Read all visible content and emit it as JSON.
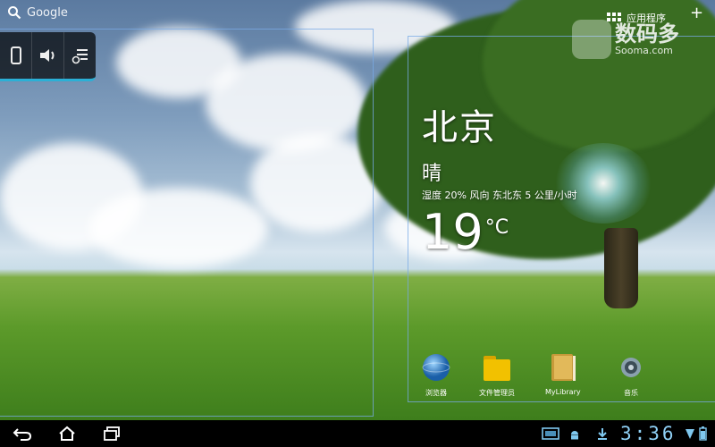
{
  "search": {
    "label": "Google"
  },
  "settings_widget": {
    "items": [
      "phone-icon",
      "volume-icon",
      "settings-list-icon"
    ]
  },
  "top_right": {
    "apps_label": "应用程序",
    "add_label": "+"
  },
  "watermark": {
    "name_cn": "数码多",
    "name_en": "Sooma.com"
  },
  "weather": {
    "city": "北京",
    "condition": "晴",
    "detail": "湿度 20% 风向 东北东 5 公里/小时",
    "temperature": "19",
    "unit": "°C"
  },
  "dock": [
    {
      "label": "浏览器",
      "icon": "globe-icon"
    },
    {
      "label": "文件管理员",
      "icon": "folder-icon"
    },
    {
      "label": "MyLibrary",
      "icon": "book-icon"
    },
    {
      "label": "音乐",
      "icon": "speaker-icon"
    }
  ],
  "navbar": {
    "buttons": [
      "back-icon",
      "home-icon",
      "recent-apps-icon"
    ],
    "time": "3:36"
  },
  "colors": {
    "accent": "#2bb0d6",
    "clock": "#8fd0f5",
    "frame": "#78aae6"
  }
}
